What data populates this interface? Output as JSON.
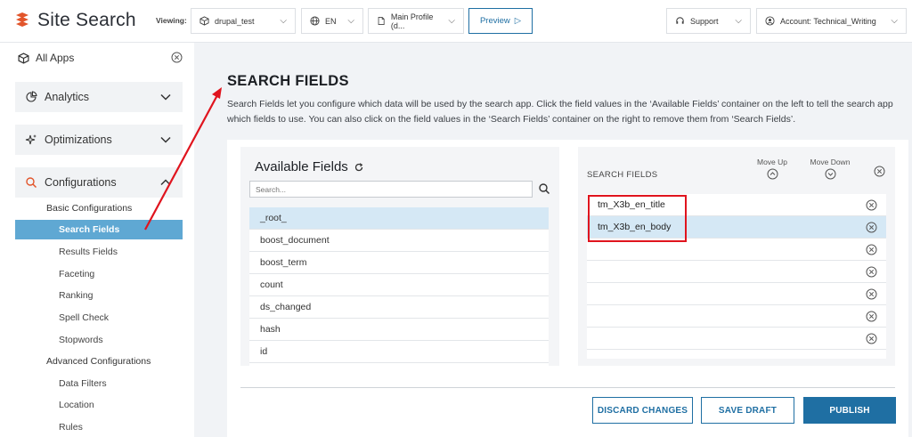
{
  "app": {
    "title": "Site Search"
  },
  "topbar": {
    "viewing_label": "Viewing:",
    "app_selector": "drupal_test",
    "language_selector": "EN",
    "profile_selector": "Main Profile (d...",
    "preview_label": "Preview",
    "support_label": "Support",
    "account_label": "Account: Technical_Writing"
  },
  "sidebar": {
    "all_apps": "All Apps",
    "groups": [
      {
        "label": "Analytics",
        "icon": "analytics-icon",
        "expanded": false
      },
      {
        "label": "Optimizations",
        "icon": "sparkle-icon",
        "expanded": false
      },
      {
        "label": "Configurations",
        "icon": "search-icon",
        "expanded": true
      }
    ],
    "basic_heading": "Basic Configurations",
    "basic_items": [
      "Search Fields",
      "Results Fields",
      "Faceting",
      "Ranking",
      "Spell Check",
      "Stopwords"
    ],
    "advanced_heading": "Advanced Configurations",
    "advanced_items": [
      "Data Filters",
      "Location",
      "Rules"
    ],
    "active_item": "Search Fields"
  },
  "main": {
    "title": "SEARCH FIELDS",
    "description": "Search Fields let you configure which data will be used by the search app. Click the field values in the ‘Available Fields’ container on the left to tell the search app which fields to use. You can also click on the field values in the ‘Search Fields’ container on the right to remove them from ‘Search Fields’.",
    "available": {
      "title": "Available Fields",
      "search_placeholder": "Search...",
      "fields": [
        "_root_",
        "boost_document",
        "boost_term",
        "count",
        "ds_changed",
        "hash",
        "id"
      ],
      "selected_index": 0
    },
    "search_fields": {
      "title": "SEARCH FIELDS",
      "move_up": "Move Up",
      "move_down": "Move Down",
      "fields": [
        "tm_X3b_en_title",
        "tm_X3b_en_body",
        "",
        "",
        "",
        "",
        ""
      ],
      "selected_index": 1
    },
    "buttons": {
      "discard": "DISCARD CHANGES",
      "save_draft": "SAVE DRAFT",
      "publish": "PUBLISH"
    }
  },
  "colors": {
    "brand_orange": "#e2552b",
    "accent_blue": "#1f6fa3",
    "active_nav": "#5fa8d3",
    "selected_row": "#d5e8f5",
    "annotation_red": "#e0141e"
  }
}
